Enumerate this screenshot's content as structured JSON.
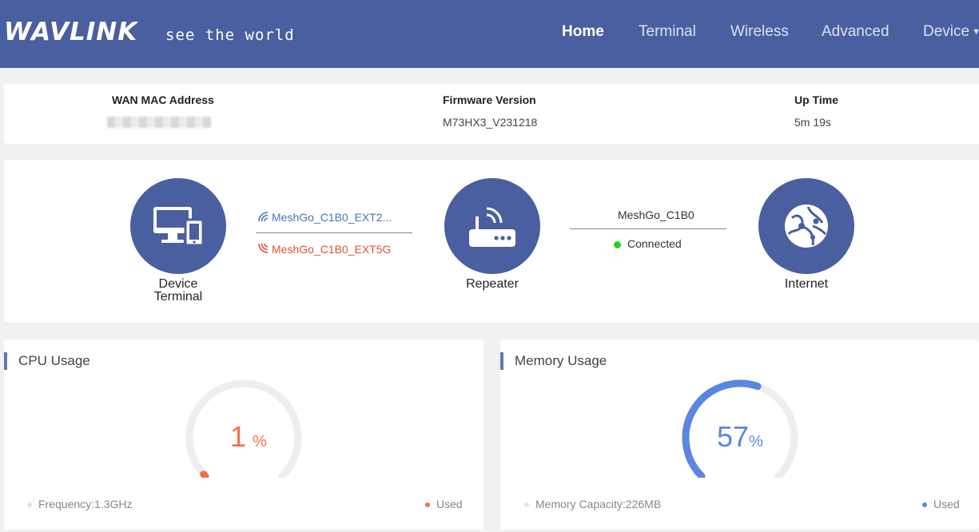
{
  "brand": {
    "logo": "WAVLINK",
    "tagline": "see the world"
  },
  "nav": [
    {
      "label": "Home",
      "active": true
    },
    {
      "label": "Terminal"
    },
    {
      "label": "Wireless"
    },
    {
      "label": "Advanced"
    },
    {
      "label": "Device"
    }
  ],
  "info": {
    "wan_mac": {
      "label": "WAN MAC Address",
      "value": ""
    },
    "firmware": {
      "label": "Firmware Version",
      "value": "M73HX3_V231218"
    },
    "uptime": {
      "label": "Up Time",
      "value": "5m 19s"
    }
  },
  "topology": {
    "device": {
      "label_line1": "Device",
      "label_line2": "Terminal",
      "icon": "devices-icon"
    },
    "ssid_24": {
      "text": "MeshGo_C1B0_EXT2...",
      "color": "#4a73b8",
      "icon": "wifi-icon"
    },
    "ssid_5": {
      "text": "MeshGo_C1B0_EXT5G",
      "color": "#e4502c",
      "icon": "wifi-icon"
    },
    "repeater": {
      "label": "Repeater",
      "icon": "router-icon"
    },
    "uplink": {
      "ssid": "MeshGo_C1B0",
      "status": "Connected",
      "status_color": "#1fd31f"
    },
    "internet": {
      "label": "Internet",
      "icon": "globe-icon"
    }
  },
  "cpu": {
    "title": "CPU Usage",
    "percent": 1,
    "value_text": "1",
    "unit": "%",
    "color": "#f0704e",
    "freq_label": "Frequency:1.3GHz",
    "used_label": "Used"
  },
  "memory": {
    "title": "Memory Usage",
    "percent": 57,
    "value_text": "57",
    "unit": "%",
    "color": "#5b86e0",
    "capacity_label": "Memory Capacity:226MB",
    "used_label": "Used"
  },
  "colors": {
    "header": "#4a5fa0",
    "accent": "#6076b4",
    "track": "#eeeeee"
  }
}
